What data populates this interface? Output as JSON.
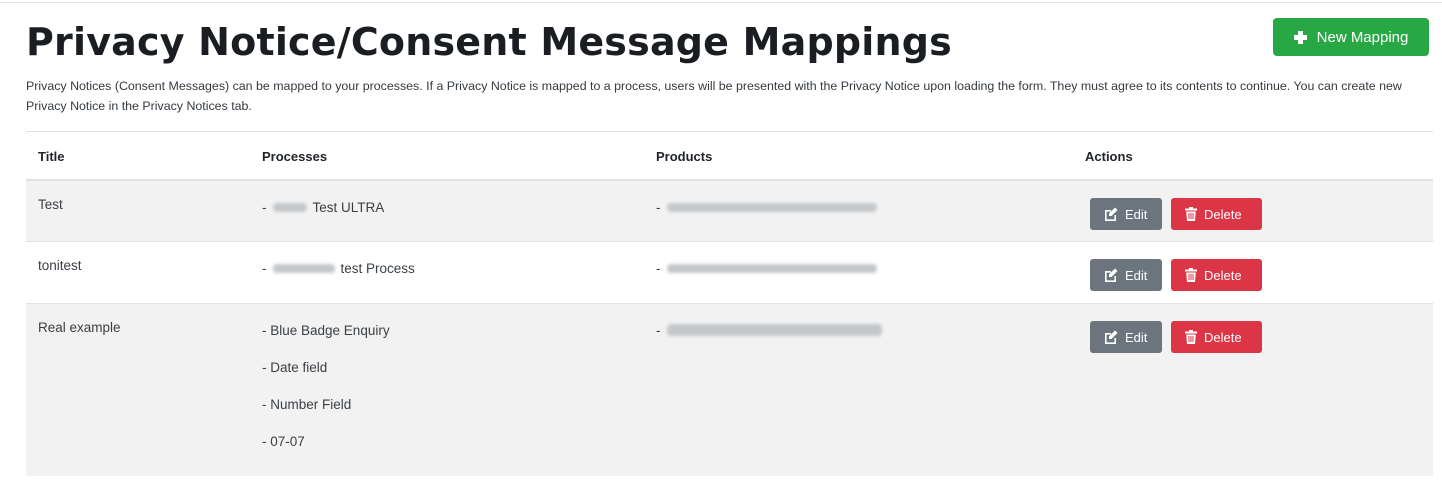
{
  "page": {
    "title": "Privacy Notice/Consent Message Mappings",
    "description": "Privacy Notices (Consent Messages) can be mapped to your processes. If a Privacy Notice is mapped to a process, users will be presented with the Privacy Notice upon loading the form. They must agree to its contents to continue. You can create new Privacy Notice in the Privacy Notices tab.",
    "new_button_label": "New Mapping"
  },
  "colors": {
    "success": "#28a745",
    "secondary": "#6c757d",
    "danger": "#dc3545",
    "stripe": "#f2f2f2"
  },
  "table": {
    "columns": [
      "Title",
      "Processes",
      "Products",
      "Actions"
    ],
    "rows": [
      {
        "title": "Test",
        "processes": [
          "- ",
          "Test ULTRA"
        ],
        "product_prefix": "- "
      },
      {
        "title": "tonitest",
        "processes": [
          "- ",
          "test Process"
        ],
        "product_prefix": "- "
      },
      {
        "title": "Real example",
        "processes": [
          "- Blue Badge Enquiry",
          "- Date field",
          "- Number Field",
          "- 07-07"
        ],
        "product_prefix": "- "
      }
    ],
    "edit_label": "Edit",
    "delete_label": "Delete"
  },
  "icons": {
    "new": "plus-icon",
    "edit": "edit-icon",
    "delete": "trash-icon"
  }
}
